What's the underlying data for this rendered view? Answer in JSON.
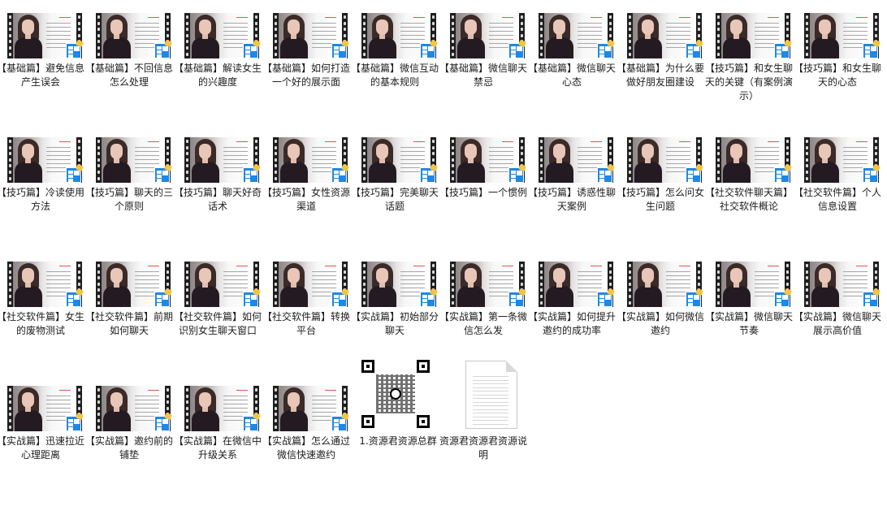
{
  "videos": [
    {
      "label": "【基础篇】避免信息产生误会"
    },
    {
      "label": "【基础篇】不回信息怎么处理"
    },
    {
      "label": "【基础篇】解读女生的兴趣度"
    },
    {
      "label": "【基础篇】如何打造一个好的展示面"
    },
    {
      "label": "【基础篇】微信互动的基本规则"
    },
    {
      "label": "【基础篇】微信聊天禁忌"
    },
    {
      "label": "【基础篇】微信聊天心态"
    },
    {
      "label": "【基础篇】为什么要做好朋友圈建设"
    },
    {
      "label": "【技巧篇】和女生聊天的关键（有案例演示）"
    },
    {
      "label": "【技巧篇】和女生聊天的心态"
    },
    {
      "label": "【技巧篇】冷读使用方法"
    },
    {
      "label": "【技巧篇】聊天的三个原则"
    },
    {
      "label": "【技巧篇】聊天好奇话术"
    },
    {
      "label": "【技巧篇】女性资源渠道"
    },
    {
      "label": "【技巧篇】完美聊天话题"
    },
    {
      "label": "【技巧篇】一个惯例"
    },
    {
      "label": "【技巧篇】诱惑性聊天案例"
    },
    {
      "label": "【技巧篇】怎么问女生问题"
    },
    {
      "label": "【社交软件聊天篇】社交软件概论"
    },
    {
      "label": "【社交软件篇】个人信息设置"
    },
    {
      "label": "【社交软件篇】女生的废物测试"
    },
    {
      "label": "【社交软件篇】前期如何聊天"
    },
    {
      "label": "【社交软件篇】如何识别女生聊天窗口"
    },
    {
      "label": "【社交软件篇】转换平台"
    },
    {
      "label": "【实战篇】初始部分聊天"
    },
    {
      "label": "【实战篇】第一条微信怎么发"
    },
    {
      "label": "【实战篇】如何提升邀约的成功率"
    },
    {
      "label": "【实战篇】如何微信邀约"
    },
    {
      "label": "【实战篇】微信聊天节奏"
    },
    {
      "label": "【实战篇】微信聊天展示高价值"
    },
    {
      "label": "【实战篇】迅速拉近心理距离"
    },
    {
      "label": "【实战篇】邀约前的铺垫"
    },
    {
      "label": "【实战篇】在微信中升级关系"
    },
    {
      "label": "【实战篇】怎么通过微信快速邀约"
    }
  ],
  "extras": [
    {
      "label": "1.资源君资源总群",
      "icon": "qr-code-icon"
    },
    {
      "label": "资源君资源君资源说明",
      "icon": "text-document-icon"
    }
  ]
}
